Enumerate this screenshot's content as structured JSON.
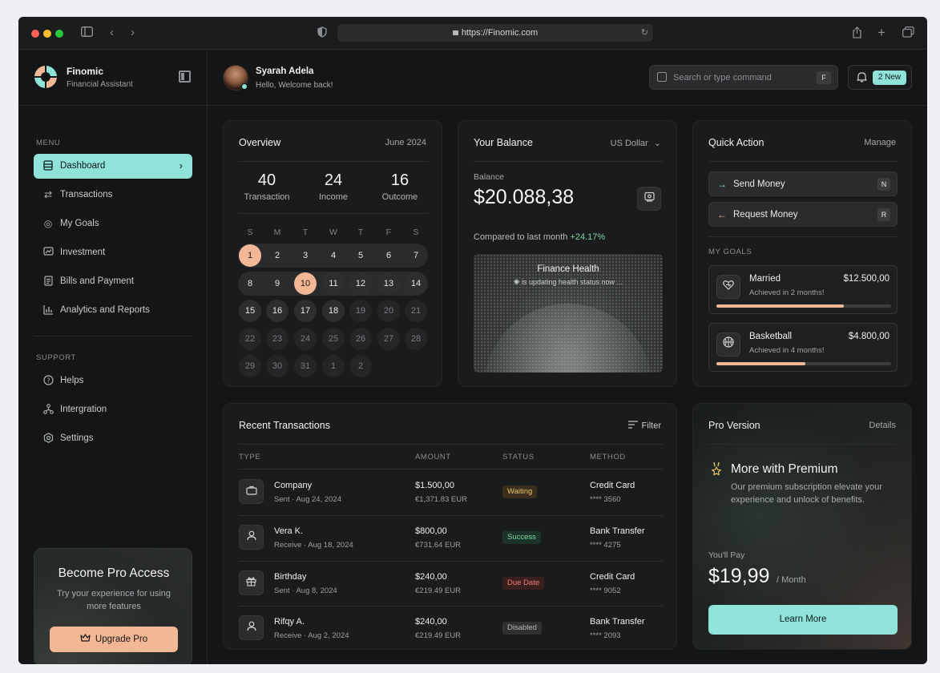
{
  "browser": {
    "url": "https://Finomic.com"
  },
  "brand": {
    "name": "Finomic",
    "subtitle": "Financial Assistant"
  },
  "sidebar": {
    "menu_label": "MENU",
    "menu": [
      {
        "label": "Dashboard",
        "icon": "dashboard-icon",
        "active": true
      },
      {
        "label": "Transactions",
        "icon": "transactions-icon"
      },
      {
        "label": "My Goals",
        "icon": "target-icon"
      },
      {
        "label": "Investment",
        "icon": "investment-icon"
      },
      {
        "label": "Bills and Payment",
        "icon": "bill-icon"
      },
      {
        "label": "Analytics and Reports",
        "icon": "analytics-icon"
      }
    ],
    "support_label": "SUPPORT",
    "support": [
      {
        "label": "Helps",
        "icon": "help-icon"
      },
      {
        "label": "Intergration",
        "icon": "integration-icon"
      },
      {
        "label": "Settings",
        "icon": "settings-icon"
      }
    ],
    "promo": {
      "title": "Become Pro Access",
      "description": "Try your experience for using more features",
      "button": "Upgrade Pro"
    }
  },
  "header": {
    "user_name": "Syarah Adela",
    "greeting": "Hello, Welcome back!",
    "search_placeholder": "Search or type command",
    "search_shortcut": "F",
    "notification_badge": "2 New"
  },
  "overview": {
    "title": "Overview",
    "month": "June 2024",
    "stats": [
      {
        "value": "40",
        "label": "Transaction"
      },
      {
        "value": "24",
        "label": "Income"
      },
      {
        "value": "16",
        "label": "Outcome"
      }
    ],
    "weekdays": [
      "S",
      "M",
      "T",
      "W",
      "T",
      "F",
      "S"
    ],
    "weeks": [
      [
        "1",
        "2",
        "3",
        "4",
        "5",
        "6",
        "7"
      ],
      [
        "8",
        "9",
        "10",
        "11",
        "12",
        "13",
        "14"
      ],
      [
        "15",
        "16",
        "17",
        "18",
        "19",
        "20",
        "21"
      ],
      [
        "22",
        "23",
        "24",
        "25",
        "26",
        "27",
        "28"
      ],
      [
        "29",
        "30",
        "31",
        "1",
        "2"
      ]
    ]
  },
  "balance": {
    "title": "Your Balance",
    "currency": "US Dollar",
    "label": "Balance",
    "value": "$20.088,38",
    "compare_text": "Compared to last month",
    "compare_pct": "+24.17%",
    "health_title": "Finance Health",
    "health_status": "is updating health status now ..."
  },
  "quick_action": {
    "title": "Quick Action",
    "manage": "Manage",
    "actions": [
      {
        "label": "Send Money",
        "key": "N"
      },
      {
        "label": "Request Money",
        "key": "R"
      }
    ],
    "goals_label": "MY GOALS",
    "goals": [
      {
        "name": "Married",
        "sub": "Achieved in 2 months!",
        "amount": "$12.500,00",
        "progress": 0.73,
        "icon": "heart-icon"
      },
      {
        "name": "Basketball",
        "sub": "Achieved in 4 months!",
        "amount": "$4.800,00",
        "progress": 0.51,
        "icon": "basketball-icon"
      }
    ]
  },
  "transactions": {
    "title": "Recent Transactions",
    "filter": "Filter",
    "columns": [
      "TYPE",
      "AMOUNT",
      "STATUS",
      "METHOD"
    ],
    "rows": [
      {
        "name": "Company",
        "sub": "Sent · Aug 24, 2024",
        "amount": "$1.500,00",
        "amount_eur": "€1,371.83 EUR",
        "status": "Waiting",
        "method": "Credit Card",
        "card": "**** 3560",
        "icon": "briefcase-icon"
      },
      {
        "name": "Vera K.",
        "sub": "Receive · Aug 18, 2024",
        "amount": "$800,00",
        "amount_eur": "€731.64 EUR",
        "status": "Success",
        "method": "Bank Transfer",
        "card": "**** 4275",
        "icon": "user-icon"
      },
      {
        "name": "Birthday",
        "sub": "Sent · Aug 8, 2024",
        "amount": "$240,00",
        "amount_eur": "€219.49 EUR",
        "status": "Due Date",
        "method": "Credit Card",
        "card": "**** 9052",
        "icon": "gift-icon"
      },
      {
        "name": "Rifqy A.",
        "sub": "Receive · Aug 2, 2024",
        "amount": "$240,00",
        "amount_eur": "€219.49 EUR",
        "status": "Disabled",
        "method": "Bank Transfer",
        "card": "**** 2093",
        "icon": "user-icon"
      }
    ],
    "status_colors": {
      "Waiting": {
        "bg": "#3a2f1c",
        "fg": "#f0c46a"
      },
      "Success": {
        "bg": "#1c3329",
        "fg": "#7fd6a4"
      },
      "Due Date": {
        "bg": "#3a1f1f",
        "fg": "#f07a7a"
      },
      "Disabled": {
        "bg": "#2f3032",
        "fg": "#b5b8ba"
      }
    }
  },
  "pro": {
    "title": "Pro Version",
    "details": "Details",
    "heading": "More with Premium",
    "description": "Our premium subscription elevate your experience and unlock of benefits.",
    "pay_label": "You'll Pay",
    "price": "$19,99",
    "per": "/ Month",
    "button": "Learn More"
  },
  "colors": {
    "accent": "#8fe3d8",
    "peach": "#f2b896",
    "background": "#141516"
  }
}
